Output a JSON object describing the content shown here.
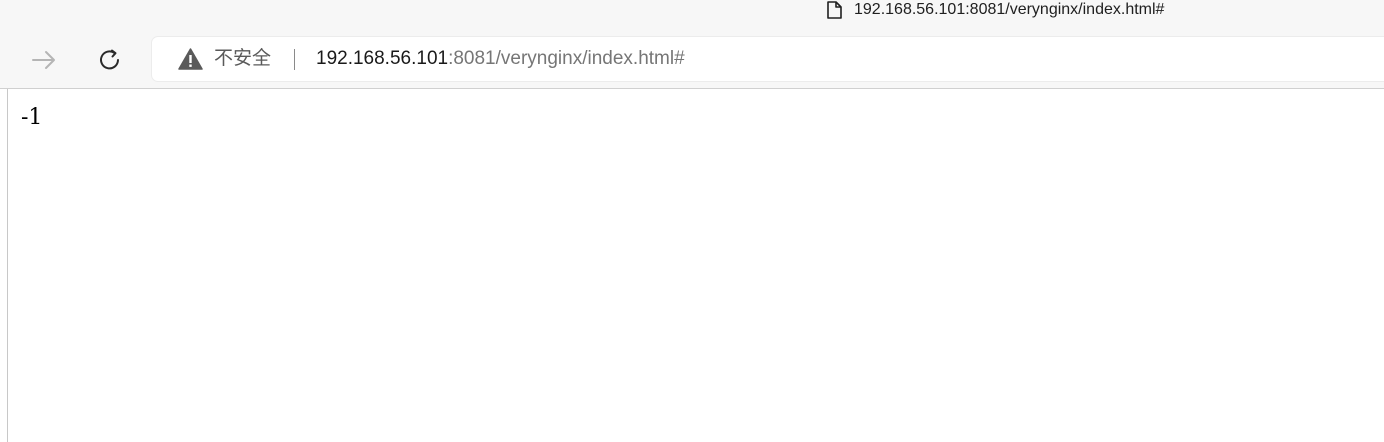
{
  "tab": {
    "title": "192.168.56.101:8081/verynginx/index.html#",
    "icon": "document-icon"
  },
  "toolbar": {
    "forward_icon": "arrow-right-icon",
    "reload_icon": "reload-icon"
  },
  "address_bar": {
    "security_icon": "warning-icon",
    "security_label": "不安全",
    "url_host": "192.168.56.101",
    "url_rest": ":8081/verynginx/index.html#"
  },
  "page": {
    "body_text": "-1"
  },
  "colors": {
    "chrome_bg": "#f7f7f7",
    "url_host": "#1a1a1a",
    "url_rest": "#767676",
    "warning_icon": "#5a5a5a"
  }
}
